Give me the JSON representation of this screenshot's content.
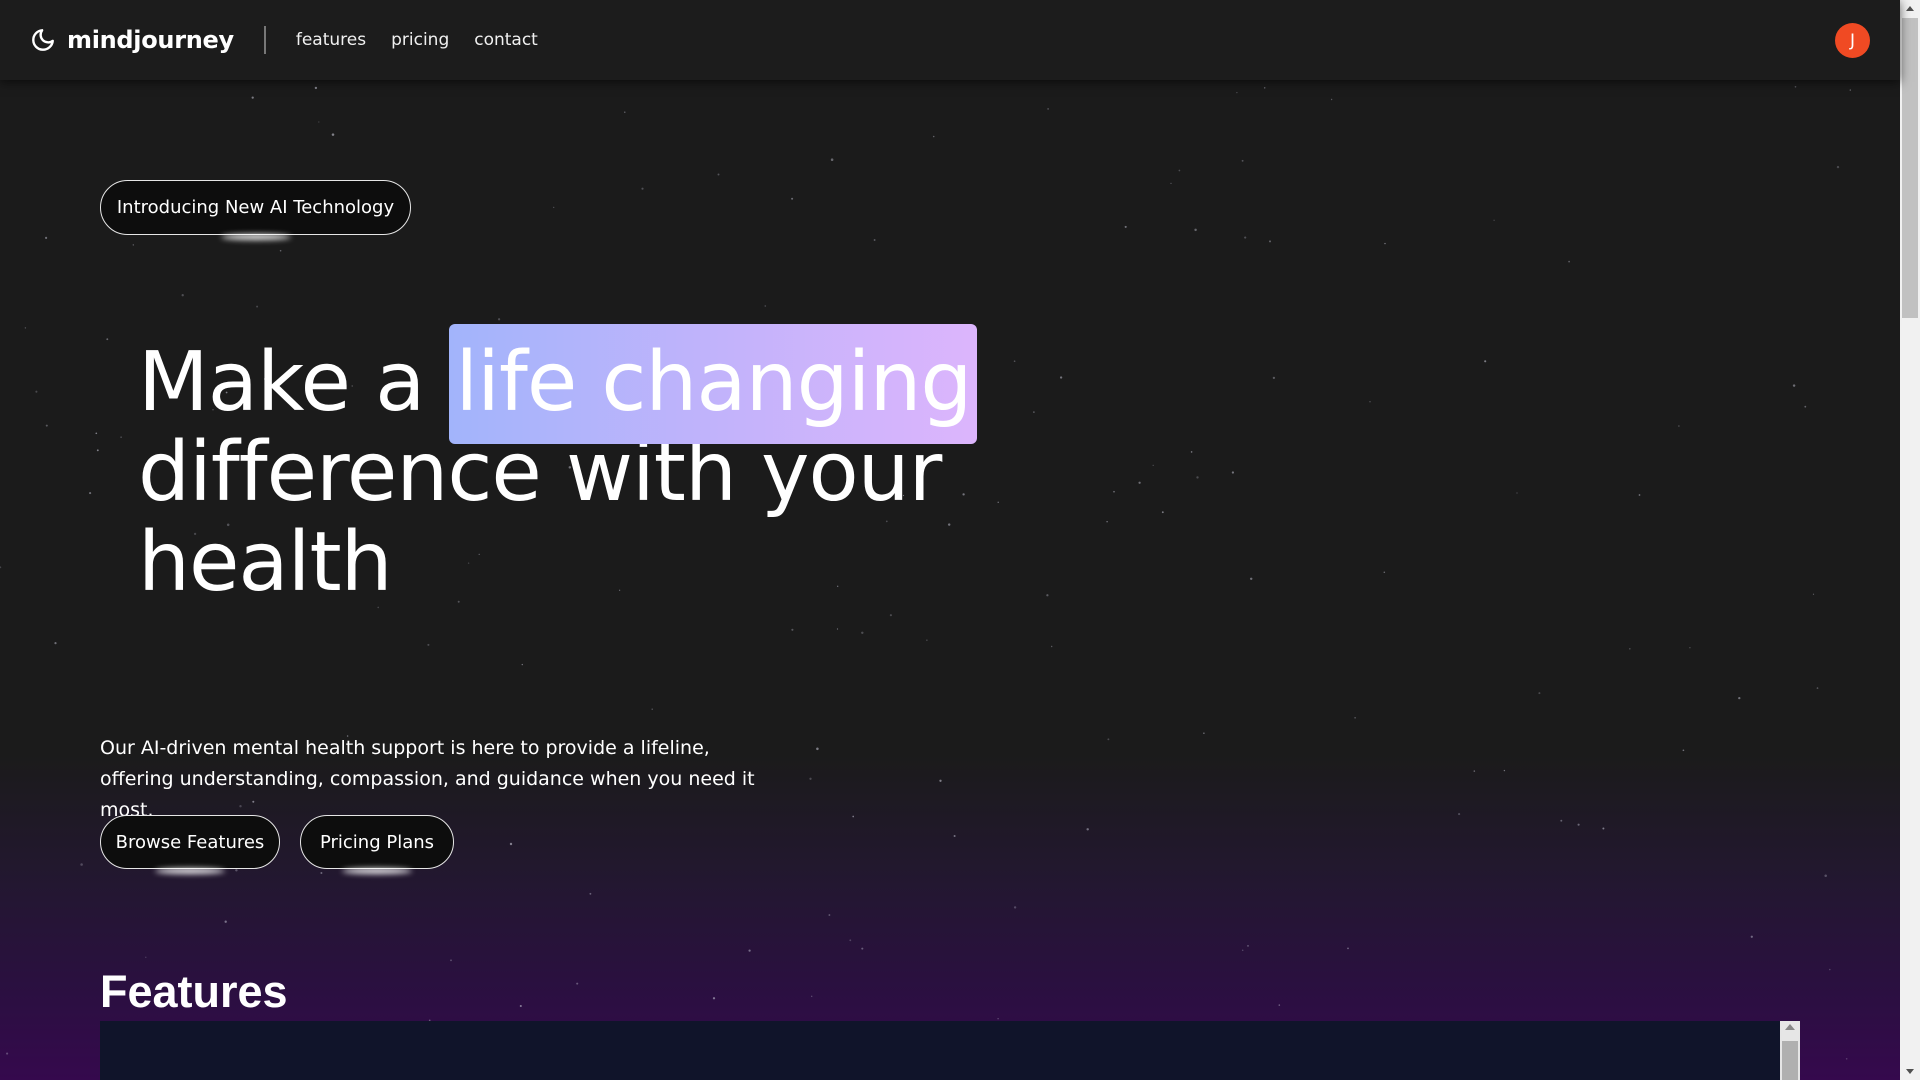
{
  "navbar": {
    "brand": "mindjourney",
    "brand_icon": "moon-icon",
    "links": [
      "features",
      "pricing",
      "contact"
    ],
    "avatar_initial": "J",
    "avatar_color": "#f04a23"
  },
  "hero": {
    "badge_label": "Introducing New AI Technology",
    "headline": {
      "before": "Make a ",
      "highlight": "life changing",
      "after": "difference with your health"
    },
    "highlight_gradient": [
      "#a2b4fb",
      "#dcb5fc"
    ],
    "description": "Our AI-driven mental health support is here to provide a lifeline, offering understanding, compassion, and guidance when you need it most.",
    "buttons": {
      "browse": "Browse Features",
      "pricing": "Pricing Plans"
    }
  },
  "features": {
    "title": "Features"
  },
  "colors": {
    "background": "#1b1b1b",
    "gradient_bottom": "#35094d",
    "panel": "#10142a"
  }
}
